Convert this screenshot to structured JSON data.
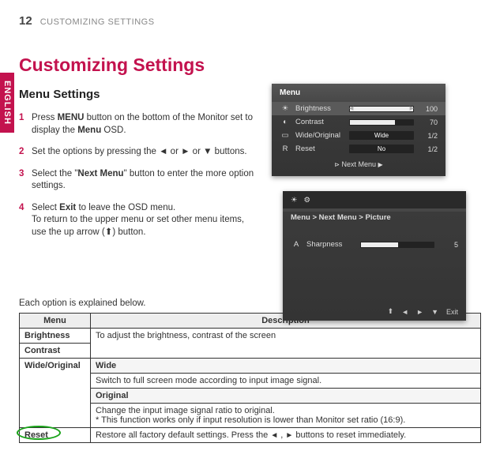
{
  "header": {
    "page_number": "12",
    "section": "CUSTOMIZING SETTINGS"
  },
  "lang_tab": "ENGLISH",
  "titles": {
    "main": "Customizing Settings",
    "sub": "Menu Settings"
  },
  "steps": [
    {
      "n": "1",
      "pre": "Press ",
      "bold1": "MENU",
      "mid": " button on the bottom of the Monitor set to display the ",
      "bold2": "Menu",
      "post": " OSD."
    },
    {
      "n": "2",
      "text": "Set the options by pressing the ◄ or ► or ▼ buttons."
    },
    {
      "n": "3",
      "pre": "Select the \"",
      "bold1": "Next Menu",
      "post": "\" button to enter the more option settings."
    },
    {
      "n": "4",
      "pre": "Select ",
      "bold1": "Exit",
      "post": " to leave the OSD menu.",
      "line2": "To return to the upper menu or set other menu items, use the up arrow (",
      "line2_icon": "⬆",
      "line2_post": ") button."
    }
  ],
  "osd1": {
    "title": "Menu",
    "rows": [
      {
        "icon": "☀",
        "label": "Brightness",
        "kind": "slider",
        "fill_pct": 100,
        "value": "100",
        "hl": true
      },
      {
        "icon": "◐",
        "label": "Contrast",
        "kind": "slider",
        "fill_pct": 70,
        "value": "70"
      },
      {
        "icon": "▭",
        "label": "Wide/Original",
        "kind": "select",
        "select": "Wide",
        "value": "1/2"
      },
      {
        "icon": "R",
        "label": "Reset",
        "kind": "select",
        "select": "No",
        "value": "1/2"
      }
    ],
    "next": {
      "left": "⊳",
      "label": "Next Menu",
      "right": "▶"
    }
  },
  "osd2": {
    "breadcrumb": "Menu  >  Next Menu  >  Picture",
    "row": {
      "icon": "A",
      "label": "Sharpness",
      "fill_pct": 50,
      "value": "5"
    },
    "footer": {
      "up": "⬆",
      "l": "◄",
      "r": "►",
      "d": "▼",
      "exit": "Exit"
    }
  },
  "table": {
    "intro": "Each option is explained below.",
    "head": {
      "menu": "Menu",
      "desc": "Description"
    },
    "brightness": "Brightness",
    "contrast": "Contrast",
    "bright_contrast_desc": "To adjust the brightness, contrast of the screen",
    "wide_orig": "Wide/Original",
    "wide_head": "Wide",
    "wide_desc": "Switch to full screen mode according to input image signal.",
    "orig_head": "Original",
    "orig_desc1": "Change the input image signal ratio to original.",
    "orig_desc2": "* This function works only if input resolution is lower than Monitor set ratio (16:9).",
    "reset": "Reset",
    "reset_desc_pre": "Restore all factory default settings. Press the ",
    "reset_l": "◄",
    "reset_comma": " , ",
    "reset_r": "►",
    "reset_desc_post": "  buttons to reset immediately."
  }
}
